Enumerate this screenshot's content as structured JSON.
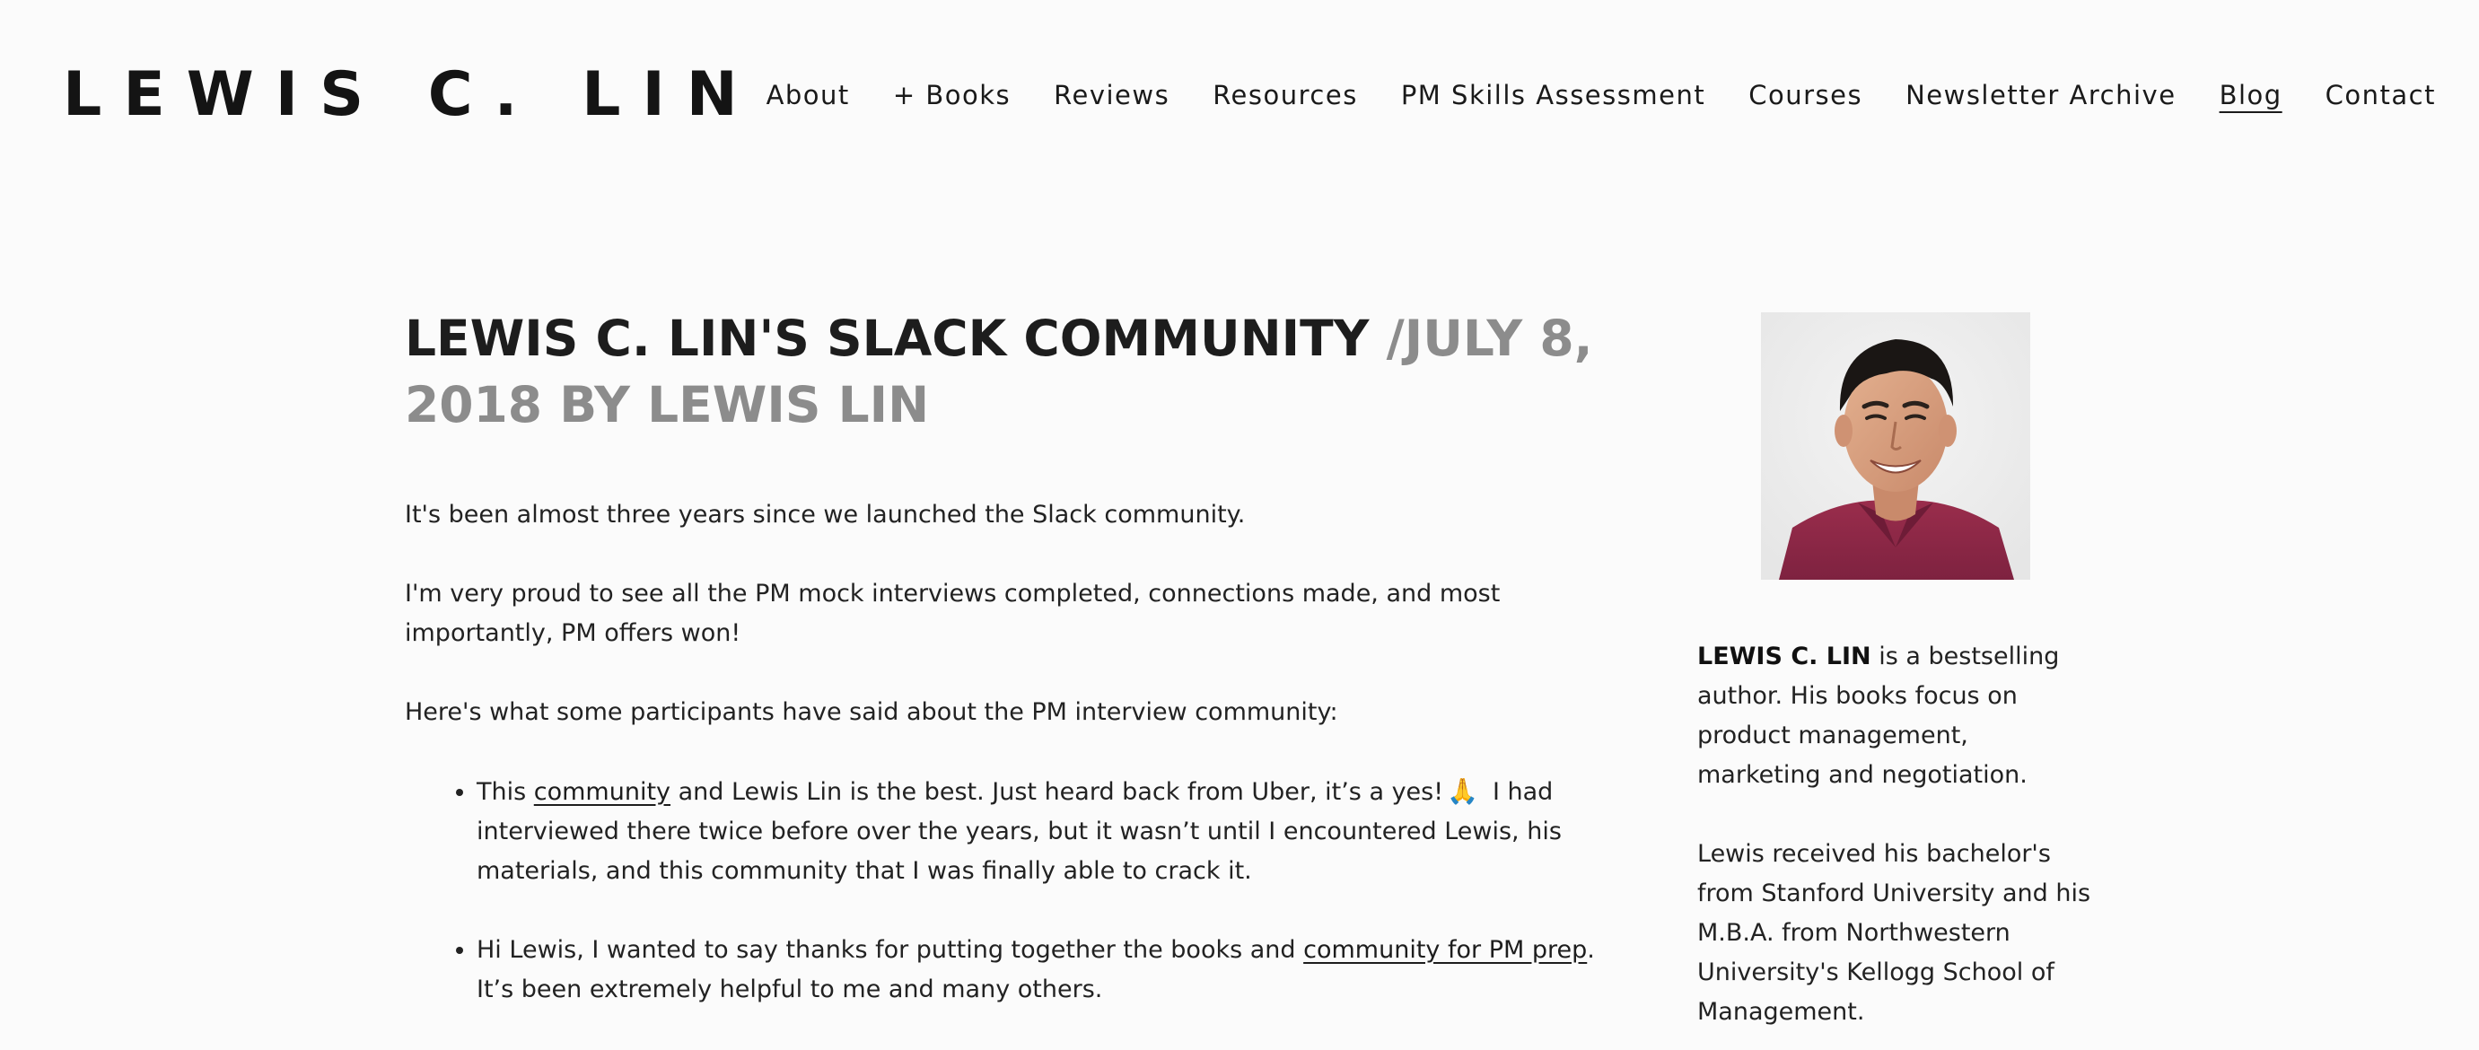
{
  "header": {
    "site_title": "LEWIS C. LIN",
    "nav": [
      {
        "label": "About"
      },
      {
        "label": "+ Books"
      },
      {
        "label": "Reviews"
      },
      {
        "label": "Resources"
      },
      {
        "label": "PM Skills Assessment"
      },
      {
        "label": "Courses"
      },
      {
        "label": "Newsletter Archive"
      },
      {
        "label": "Blog",
        "active": true
      },
      {
        "label": "Contact"
      }
    ]
  },
  "post": {
    "title": "LEWIS C. LIN'S SLACK COMMUNITY",
    "meta": " /JULY 8, 2018 BY LEWIS LIN",
    "p1": "It's been almost three years since we launched the Slack community.",
    "p2": "I'm very proud to see all the PM mock interviews completed, connections made, and most importantly, PM offers won!",
    "p3": "Here's what some participants have said about the PM interview community:",
    "quote1": {
      "before": "This ",
      "link": "community",
      "middle": " and Lewis Lin is the best. Just heard back from Uber, it’s a yes!",
      "emoji": "🙏",
      "after": "I had interviewed there twice before over the years, but it wasn’t until I encountered Lewis, his materials, and this community that I was finally able to crack it."
    },
    "quote2": {
      "before": "Hi Lewis, I wanted to say thanks for putting together the books and ",
      "link": "community for PM prep",
      "after": ". It’s been extremely helpful to me and many others."
    }
  },
  "sidebar": {
    "bio_name": "LEWIS C. LIN",
    "bio_text": " is a bestselling author. His books focus on product management, marketing and negotiation.",
    "bio_education": "Lewis received his bachelor's from Stanford University and his M.B.A. from Northwestern University's Kellogg School of Management."
  },
  "colors": {
    "background": "#fbfbfb",
    "text": "#1d1d1d",
    "meta_gray": "#8c8c8c",
    "shirt": "#8b2744"
  }
}
